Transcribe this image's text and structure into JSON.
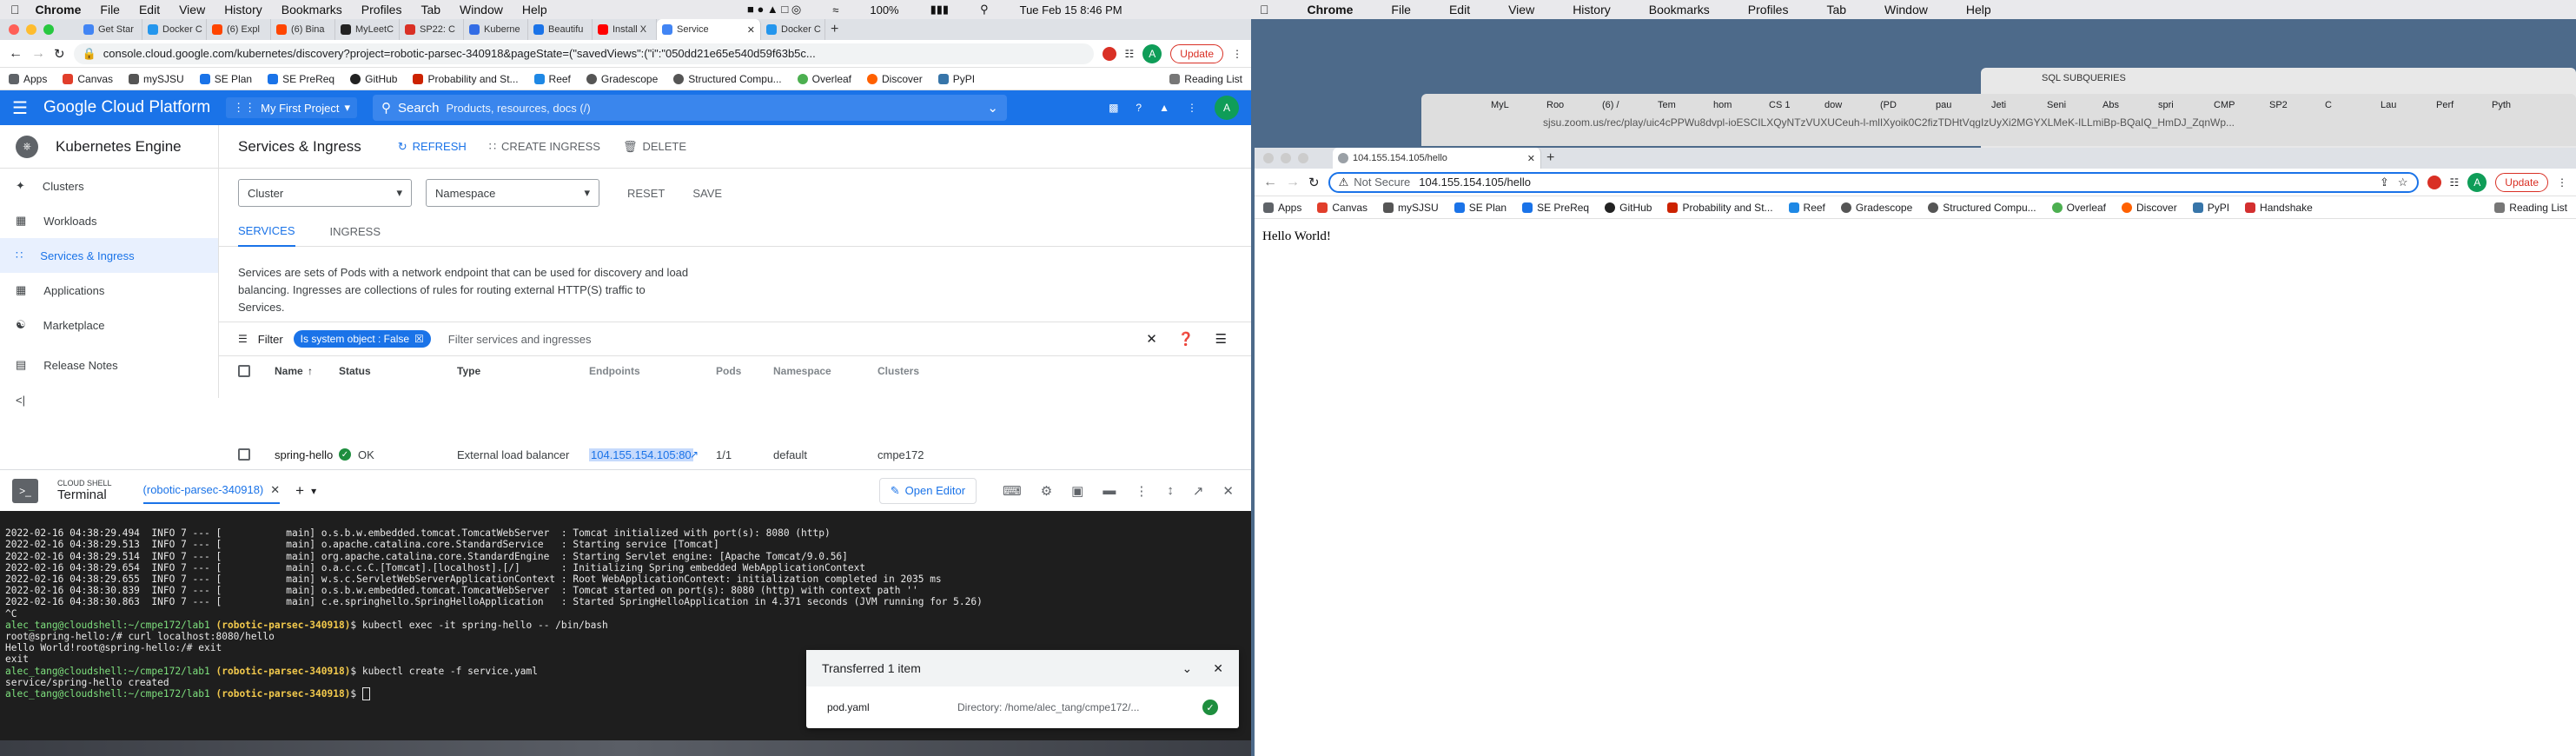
{
  "menubar": {
    "app": "Chrome",
    "items": [
      "File",
      "Edit",
      "View",
      "History",
      "Bookmarks",
      "Profiles",
      "Tab",
      "Window",
      "Help"
    ],
    "battery": "100%",
    "clock": "Tue Feb 15  8:46 PM"
  },
  "menubar_right": {
    "app": "Chrome",
    "items": [
      "File",
      "Edit",
      "View",
      "History",
      "Bookmarks",
      "Profiles",
      "Tab",
      "Window",
      "Help"
    ]
  },
  "left": {
    "tabs": [
      "Get Star",
      "Docker C",
      "(6) Expl",
      "(6) Bina",
      "MyLeetC",
      "SP22: C",
      "Kuberne",
      "Beautifu",
      "Install X",
      "Service",
      "Docker C"
    ],
    "url": "console.cloud.google.com/kubernetes/discovery?project=robotic-parsec-340918&pageState=(\"savedViews\":(\"i\":\"050dd21e65e540d59f63b5c...",
    "update": "Update",
    "reading_list": "Reading List",
    "bookmarks": [
      "Apps",
      "Canvas",
      "mySJSU",
      "SE Plan",
      "SE PreReq",
      "GitHub",
      "Probability and St...",
      "Reef",
      "Gradescope",
      "Structured Compu...",
      "Overleaf",
      "Discover",
      "PyPI"
    ],
    "gcp": {
      "brand": "Google Cloud Platform",
      "project": "My First Project",
      "search_label": "Search",
      "search_placeholder": "Products, resources, docs (/)",
      "avatar": "A"
    },
    "engine": "Kubernetes Engine",
    "nav": [
      "Clusters",
      "Workloads",
      "Services & Ingress",
      "Applications",
      "Marketplace",
      "Release Notes"
    ],
    "page_title": "Services & Ingress",
    "actions": {
      "refresh": "REFRESH",
      "create": "CREATE INGRESS",
      "delete": "DELETE"
    },
    "filters": {
      "cluster": "Cluster",
      "namespace": "Namespace",
      "reset": "RESET",
      "save": "SAVE"
    },
    "tabs2": [
      "SERVICES",
      "INGRESS"
    ],
    "description": "Services are sets of Pods with a network endpoint that can be used for discovery and load balancing. Ingresses are collections of rules for routing external HTTP(S) traffic to Services.",
    "filter_bar": {
      "label": "Filter",
      "chip": "Is system object : False",
      "placeholder": "Filter services and ingresses"
    },
    "table": {
      "headers": [
        "Name",
        "Status",
        "Type",
        "Endpoints",
        "Pods",
        "Namespace",
        "Clusters"
      ],
      "row": {
        "name": "spring-hello",
        "status": "OK",
        "type": "External load balancer",
        "endpoint": "104.155.154.105:80",
        "pods": "1/1",
        "namespace": "default",
        "cluster": "cmpe172"
      }
    },
    "shell": {
      "label": "CLOUD SHELL",
      "title": "Terminal",
      "tab": "(robotic-parsec-340918)",
      "open_editor": "Open Editor"
    },
    "terminal_lines": [
      "2022-02-16 04:38:29.494  INFO 7 --- [           main] o.s.b.w.embedded.tomcat.TomcatWebServer  : Tomcat initialized with port(s): 8080 (http)",
      "2022-02-16 04:38:29.513  INFO 7 --- [           main] o.apache.catalina.core.StandardService   : Starting service [Tomcat]",
      "2022-02-16 04:38:29.514  INFO 7 --- [           main] org.apache.catalina.core.StandardEngine  : Starting Servlet engine: [Apache Tomcat/9.0.56]",
      "2022-02-16 04:38:29.654  INFO 7 --- [           main] o.a.c.c.C.[Tomcat].[localhost].[/]       : Initializing Spring embedded WebApplicationContext",
      "2022-02-16 04:38:29.655  INFO 7 --- [           main] w.s.c.ServletWebServerApplicationContext : Root WebApplicationContext: initialization completed in 2035 ms",
      "2022-02-16 04:38:30.839  INFO 7 --- [           main] o.s.b.w.embedded.tomcat.TomcatWebServer  : Tomcat started on port(s): 8080 (http) with context path ''",
      "2022-02-16 04:38:30.863  INFO 7 --- [           main] c.e.springhello.SpringHelloApplication   : Started SpringHelloApplication in 4.371 seconds (JVM running for 5.26)",
      "",
      "^C"
    ],
    "prompt_user": "alec_tang@cloudshell:~/cmpe172/lab1",
    "prompt_project": "(robotic-parsec-340918)",
    "cmd1": "$ kubectl exec -it spring-hello -- /bin/bash",
    "line_curl": "root@spring-hello:/# curl localhost:8080/hello",
    "line_hello": "Hello World!root@spring-hello:/# exit",
    "line_exit": "exit",
    "cmd2": "$ kubectl create -f service.yaml",
    "line_created": "service/spring-hello created",
    "cmd3": "$ ",
    "download": {
      "title": "Transferred 1 item",
      "file": "pod.yaml",
      "dir": "Directory: /home/alec_tang/cmpe172/..."
    }
  },
  "right": {
    "back_title": "SQL SUBQUERIES",
    "back_tabs": [
      "MyL",
      "Roo",
      "(6) /",
      "Tem",
      "hom",
      "CS 1",
      "dow",
      "(PD",
      "pau",
      "Jeti",
      "Seni",
      "Abs",
      "spri",
      "CMP",
      "SP2",
      "C",
      "Lau",
      "Perf",
      "Pyth"
    ],
    "back_url": "sjsu.zoom.us/rec/play/uic4cPPWu8dvpl-ioESCILXQyNTzVUXUCeuh-l-mlIXyoik0C2fizTDHtVqgIzUyXi2MGYXLMeK-ILLmiBp-BQaIQ_HmDJ_ZqnWp...",
    "tab_title": "104.155.154.105/hello",
    "not_secure": "Not Secure",
    "url": "104.155.154.105/hello",
    "update": "Update",
    "avatar": "A",
    "reading_list": "Reading List",
    "bookmarks": [
      "Apps",
      "Canvas",
      "mySJSU",
      "SE Plan",
      "SE PreReq",
      "GitHub",
      "Probability and St...",
      "Reef",
      "Gradescope",
      "Structured Compu...",
      "Overleaf",
      "Discover",
      "PyPI",
      "Handshake"
    ],
    "body_text": "Hello World!"
  },
  "colors": {
    "accent": "#1a73e8",
    "update": "#d93025",
    "ok": "#1e8e3e",
    "prompt": "#f2c94c"
  }
}
